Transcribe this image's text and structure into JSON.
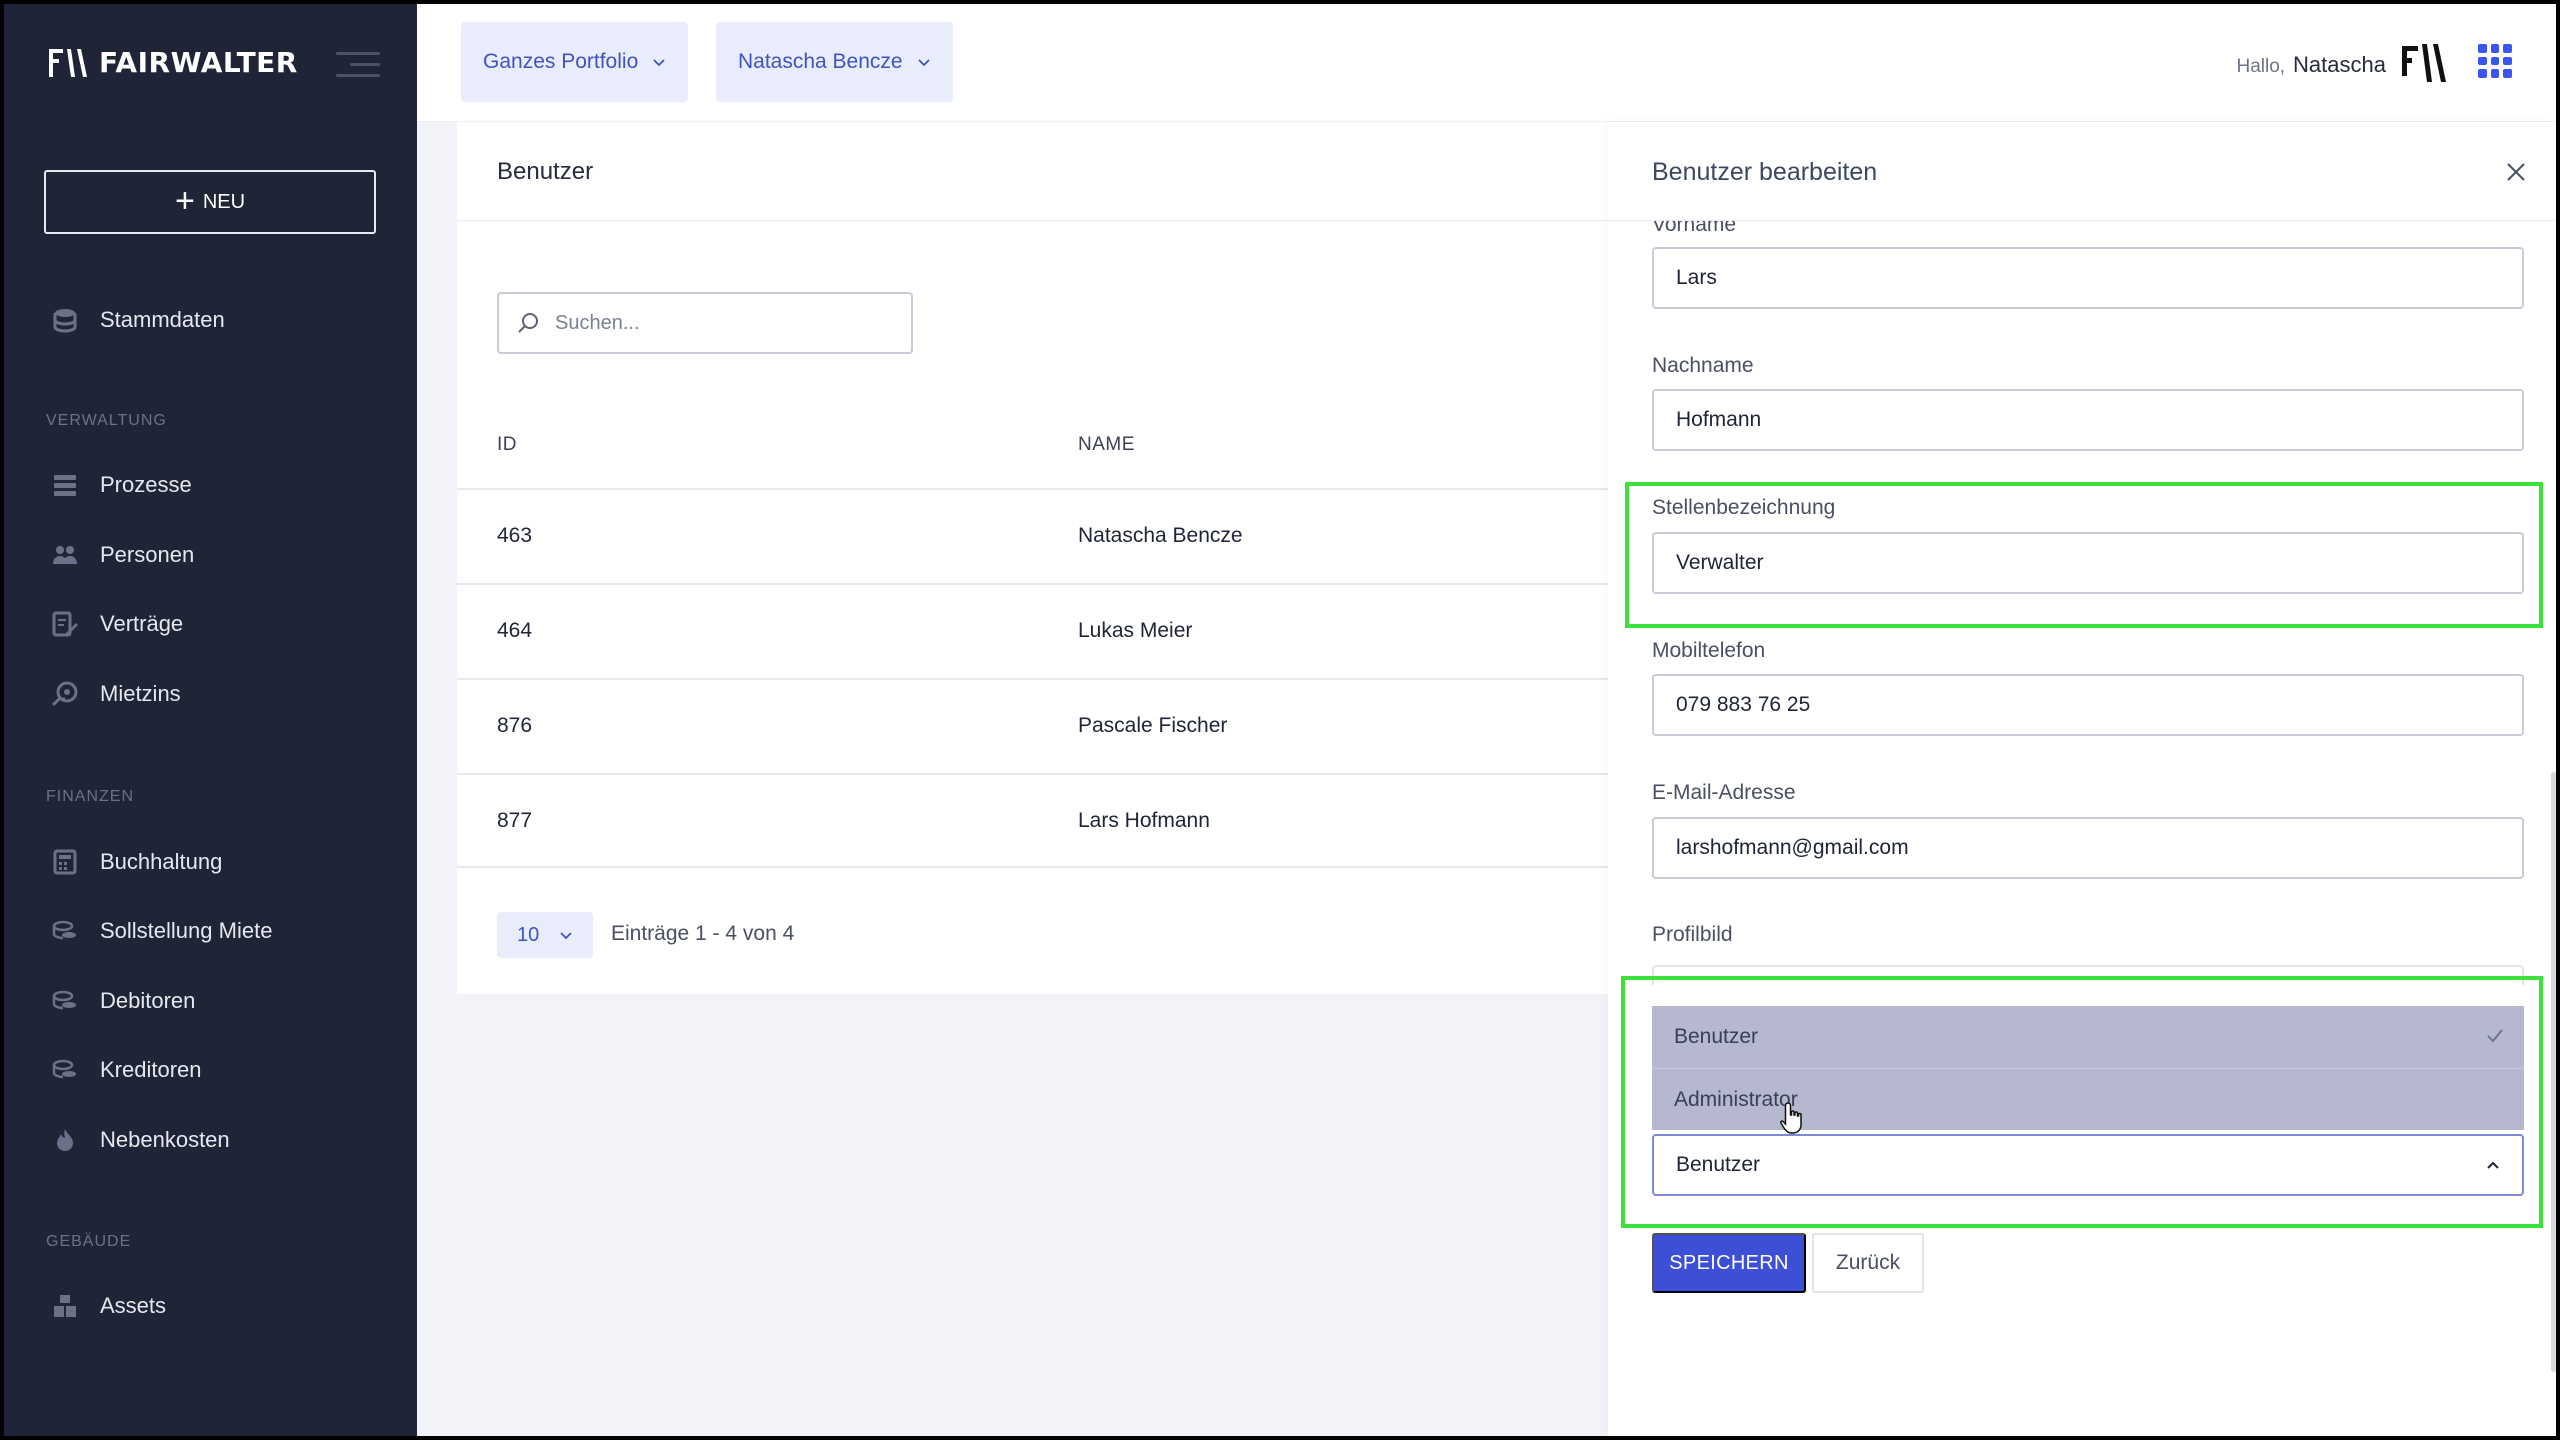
{
  "app": {
    "logo_text": "FAIRWALTER",
    "new_button_label": "NEU"
  },
  "sidebar": {
    "top_items": [
      {
        "label": "Stammdaten",
        "icon": "database-icon"
      }
    ],
    "sections": [
      {
        "title": "VERWALTUNG",
        "items": [
          {
            "label": "Prozesse",
            "icon": "list-icon"
          },
          {
            "label": "Personen",
            "icon": "users-icon"
          },
          {
            "label": "Verträge",
            "icon": "contract-edit-icon"
          },
          {
            "label": "Mietzins",
            "icon": "rent-icon"
          }
        ]
      },
      {
        "title": "FINANZEN",
        "items": [
          {
            "label": "Buchhaltung",
            "icon": "calculator-icon"
          },
          {
            "label": "Sollstellung Miete",
            "icon": "coins-icon"
          },
          {
            "label": "Debitoren",
            "icon": "coins-icon"
          },
          {
            "label": "Kreditoren",
            "icon": "coins-icon"
          },
          {
            "label": "Nebenkosten",
            "icon": "flame-icon"
          }
        ]
      },
      {
        "title": "GEBÄUDE",
        "items": [
          {
            "label": "Assets",
            "icon": "buildings-icon"
          }
        ]
      }
    ]
  },
  "topbar": {
    "portfolio_chip": "Ganzes Portfolio",
    "user_chip": "Natascha Bencze",
    "greeting": "Hallo,",
    "user_name": "Natascha"
  },
  "users_card": {
    "title": "Benutzer",
    "search_placeholder": "Suchen...",
    "columns": [
      "ID",
      "NAME"
    ],
    "rows": [
      {
        "id": "463",
        "name": "Natascha Bencze"
      },
      {
        "id": "464",
        "name": "Lukas Meier"
      },
      {
        "id": "876",
        "name": "Pascale Fischer"
      },
      {
        "id": "877",
        "name": "Lars Hofmann"
      }
    ],
    "page_size": "10",
    "pager_text": "Einträge 1 - 4 von 4"
  },
  "edit_panel": {
    "title": "Benutzer bearbeiten",
    "fields": {
      "vorname_label": "Vorname",
      "vorname_value": "Lars",
      "nachname_label": "Nachname",
      "nachname_value": "Hofmann",
      "stelle_label": "Stellenbezeichnung",
      "stelle_value": "Verwalter",
      "mobil_label": "Mobiltelefon",
      "mobil_value": "079 883 76 25",
      "email_label": "E-Mail-Adresse",
      "email_value": "larshofmann@gmail.com",
      "profilbild_label": "Profilbild"
    },
    "role_options": [
      "Benutzer",
      "Administrator"
    ],
    "role_selected": "Benutzer",
    "save_label": "SPEICHERN",
    "back_label": "Zurück"
  },
  "colors": {
    "sidebar_bg": "#1f2536",
    "accent": "#3d4fd6",
    "chip_bg": "#e9edfb",
    "highlight": "#3ee03a",
    "dropdown_bg": "#b5b8cf"
  }
}
